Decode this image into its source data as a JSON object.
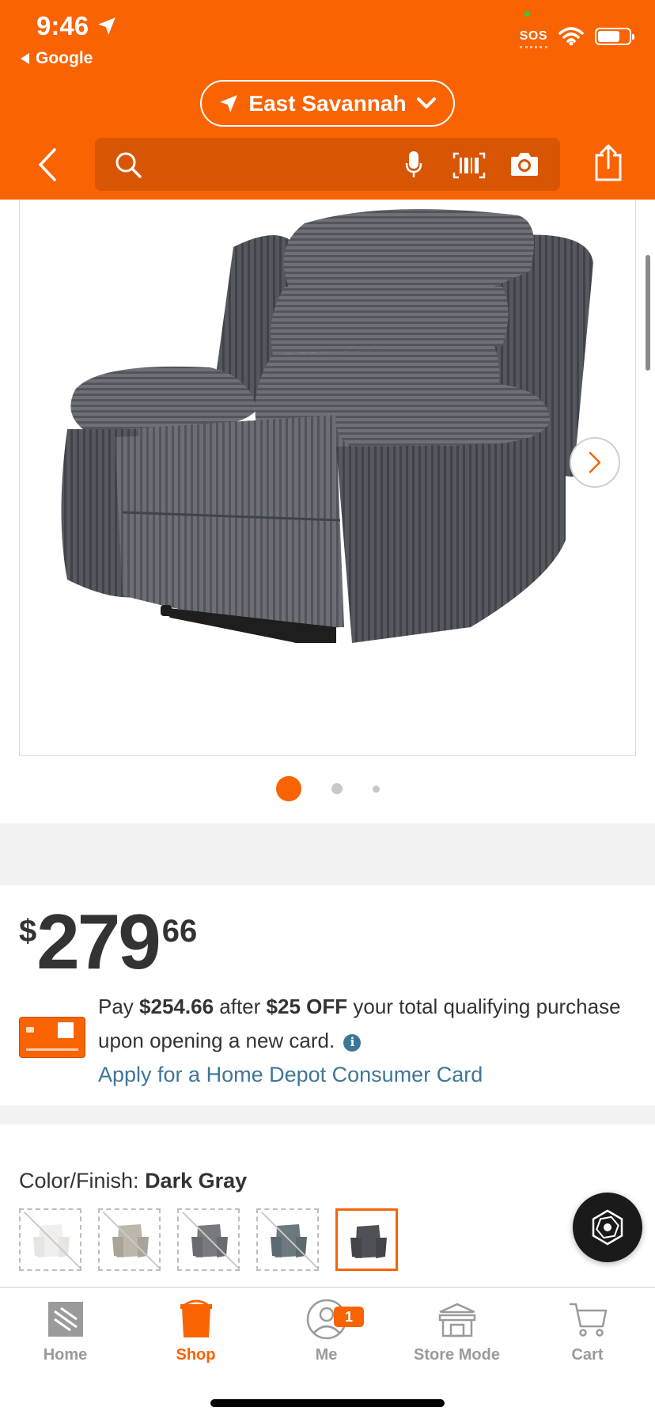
{
  "status_bar": {
    "time": "9:46",
    "back_app": "Google",
    "sos": "SOS"
  },
  "header": {
    "store_name": "East Savannah",
    "search_placeholder": ""
  },
  "gallery": {
    "image_alt": "Dark gray corduroy recliner chair",
    "image_count": 3,
    "active_index": 0
  },
  "price": {
    "currency": "$",
    "dollars": "279",
    "cents": "66"
  },
  "promo": {
    "pay_prefix": "Pay",
    "pay_amount": "$254.66",
    "after": "after",
    "discount": "$25 OFF",
    "rest": "your total qualifying purchase upon opening a new card.",
    "apply_link": "Apply for a Home Depot Consumer Card"
  },
  "color": {
    "label": "Color/Finish:",
    "selected": "Dark Gray",
    "swatches": [
      {
        "name": "White",
        "color": "#f0efec",
        "available": false
      },
      {
        "name": "Beige",
        "color": "#bdb6ab",
        "available": false
      },
      {
        "name": "Gray",
        "color": "#777b7f",
        "available": false
      },
      {
        "name": "Blue Gray",
        "color": "#6c7a80",
        "available": false
      },
      {
        "name": "Dark Gray",
        "color": "#4e5257",
        "available": true
      }
    ]
  },
  "tabs": [
    {
      "label": "Home",
      "icon": "home-depot-logo-icon",
      "active": false
    },
    {
      "label": "Shop",
      "icon": "bucket-icon",
      "active": true
    },
    {
      "label": "Me",
      "icon": "person-icon",
      "active": false,
      "badge": "1"
    },
    {
      "label": "Store Mode",
      "icon": "store-icon",
      "active": false
    },
    {
      "label": "Cart",
      "icon": "cart-icon",
      "active": false
    }
  ],
  "colors": {
    "brand_orange": "#f96302",
    "link_blue": "#3e7697"
  }
}
